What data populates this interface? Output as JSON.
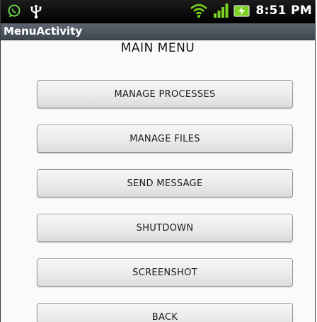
{
  "status_bar": {
    "time": "8:51 PM",
    "icons": [
      "whatsapp-icon",
      "usb-icon",
      "wifi-icon",
      "signal-icon",
      "battery-charging-icon"
    ]
  },
  "title_bar": {
    "title": "MenuActivity"
  },
  "main": {
    "heading": "MAIN MENU",
    "buttons": [
      {
        "label": "MANAGE PROCESSES"
      },
      {
        "label": "MANAGE FILES"
      },
      {
        "label": "SEND MESSAGE"
      },
      {
        "label": "SHUTDOWN"
      },
      {
        "label": "SCREENSHOT"
      },
      {
        "label": "BACK"
      }
    ]
  },
  "colors": {
    "status_bar_bg": "#000000",
    "title_bar_bg": "#4a525b",
    "wifi_signal_green": "#7bd11f"
  }
}
